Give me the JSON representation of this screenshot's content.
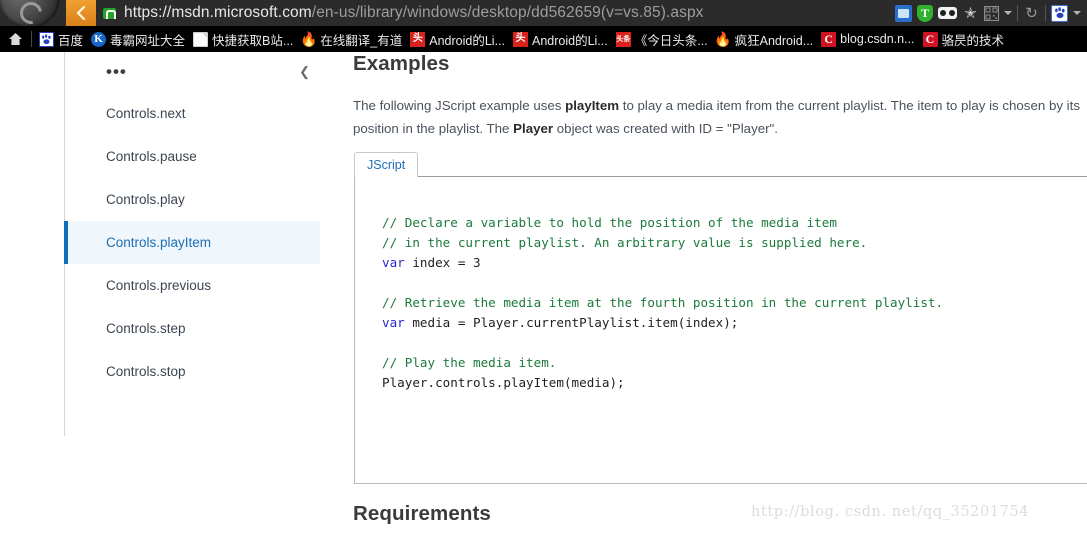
{
  "browser": {
    "back_icon": "back-arrow-icon",
    "lock_icon": "ssl-lock-icon",
    "url_host": "https://msdn.microsoft.com",
    "url_path": "/en-us/library/windows/desktop/dd562659(v=vs.85).aspx",
    "url_full": "https://msdn.microsoft.com/en-us/library/windows/desktop/dd562659(v=vs.85).aspx",
    "toolbar_icons": [
      "screenshot-icon",
      "tencent-shield-icon",
      "glasses-icon",
      "favorite-star-icon",
      "qr-code-icon",
      "dropdown-caret-icon",
      "reload-icon",
      "baidu-paw-icon",
      "dropdown-caret-icon"
    ],
    "reload_glyph": "↻",
    "star_glyph": "✭",
    "shield_letter": "T"
  },
  "bookmarks": {
    "home_icon": "home-icon",
    "items": [
      {
        "icon": "baidu-paw-icon",
        "label": "百度"
      },
      {
        "icon": "kingsoft-k-icon",
        "label": "毒霸网址大全"
      },
      {
        "icon": "document-icon",
        "label": "快捷获取B站..."
      },
      {
        "icon": "flame-icon",
        "label": "在线翻译_有道"
      },
      {
        "icon": "toutiao-icon",
        "label": "Android的Li..."
      },
      {
        "icon": "toutiao-icon",
        "label": "Android的Li..."
      },
      {
        "icon": "toutiao-app-icon",
        "label": "《今日头条..."
      },
      {
        "icon": "flame-icon",
        "label": "疯狂Android..."
      },
      {
        "icon": "csdn-icon",
        "label": "blog.csdn.n..."
      },
      {
        "icon": "csdn-icon",
        "label": "骆昃的技术"
      }
    ]
  },
  "sidebar": {
    "more_icon": "ellipsis-icon",
    "collapse_icon": "chevron-left-icon",
    "items": [
      {
        "label": "Controls.next",
        "active": false
      },
      {
        "label": "Controls.pause",
        "active": false
      },
      {
        "label": "Controls.play",
        "active": false
      },
      {
        "label": "Controls.playItem",
        "active": true
      },
      {
        "label": "Controls.previous",
        "active": false
      },
      {
        "label": "Controls.step",
        "active": false
      },
      {
        "label": "Controls.stop",
        "active": false
      }
    ],
    "active_accent_color": "#0a70bd",
    "active_bg_color": "#eff7fc"
  },
  "main": {
    "examples_heading": "Examples",
    "paragraph": {
      "part1": "The following JScript example uses ",
      "bold1": "playItem",
      "part2": " to play a media item from the current playlist. The item to play is chosen by its position in the playlist. The ",
      "bold2": "Player",
      "part3": " object was created with ID = \"Player\"."
    },
    "code_tab_label": "JScript",
    "code_lines": [
      "// Declare a variable to hold the position of the media item",
      "// in the current playlist. An arbitrary value is supplied here.",
      "var index = 3",
      "",
      "// Retrieve the media item at the fourth position in the current playlist.",
      "var media = Player.currentPlaylist.item(index);",
      "",
      "// Play the media item.",
      "Player.controls.playItem(media);"
    ],
    "requirements_heading": "Requirements",
    "watermark": "http://blog. csdn. net/qq_35201754"
  }
}
